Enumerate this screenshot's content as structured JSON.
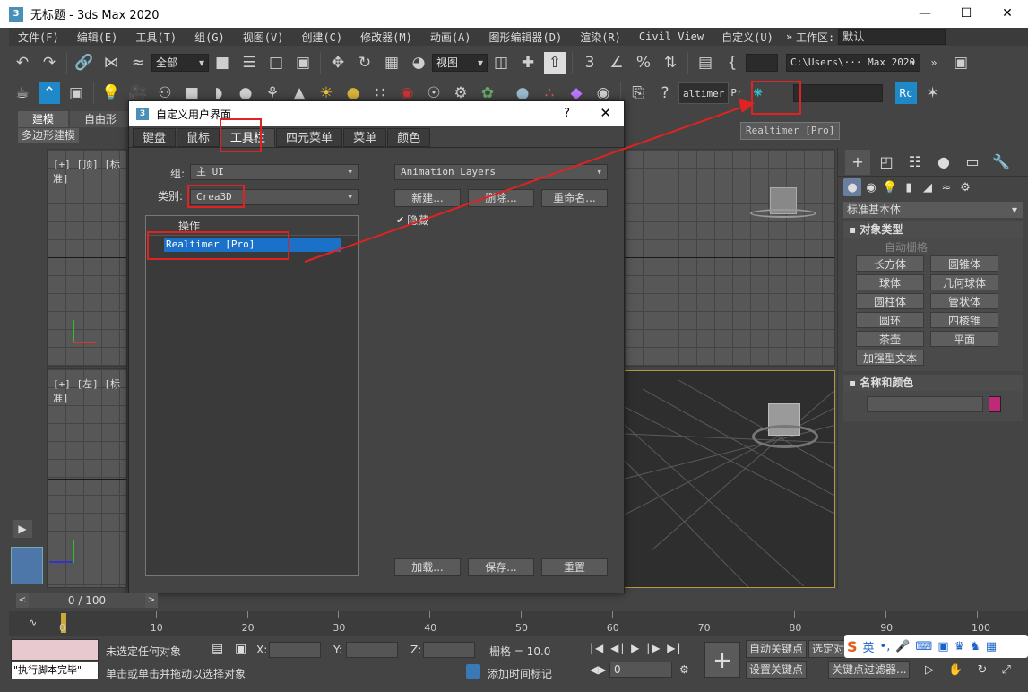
{
  "window": {
    "title": "无标题 - 3ds Max 2020",
    "app_icon": "3",
    "controls": [
      "minimize-icon",
      "maximize-icon",
      "close-icon"
    ]
  },
  "menubar": {
    "items": [
      "文件(F)",
      "编辑(E)",
      "工具(T)",
      "组(G)",
      "视图(V)",
      "创建(C)",
      "修改器(M)",
      "动画(A)",
      "图形编辑器(D)",
      "渲染(R)",
      "Civil View",
      "自定义(U)"
    ],
    "overflow": "»",
    "workspace_label": "工作区:",
    "workspace_value": "默认"
  },
  "toolbar1": {
    "selection_filter": "全部",
    "ref_coord": "视图",
    "path": "C:\\Users\\··· Max 2020"
  },
  "toolbar2": {
    "realtimer_button": "altimer",
    "realtimer_suffix": "Pr"
  },
  "tooltip": "Realtimer [Pro]",
  "ribbon": {
    "tabs": [
      "建模",
      "自由形"
    ],
    "panel": "多边形建模"
  },
  "viewports": {
    "top_label": "[+] [顶] [标准]",
    "left_label": "[+] [左] [标准]"
  },
  "dialog": {
    "title": "自定义用户界面",
    "help": "?",
    "tabs": [
      "键盘",
      "鼠标",
      "工具栏",
      "四元菜单",
      "菜单",
      "颜色"
    ],
    "active_tab": "工具栏",
    "group_label": "组:",
    "group_value": "主 UI",
    "category_label": "类别:",
    "category_value": "Crea3D",
    "list_header": "操作",
    "list_items": [
      "Realtimer [Pro]"
    ],
    "toolbar_select": "Animation Layers",
    "buttons": {
      "new": "新建...",
      "delete": "删除...",
      "rename": "重命名...",
      "load": "加载...",
      "save": "保存...",
      "reset": "重置"
    },
    "hide_checkbox": "隐藏",
    "hide_checked": true
  },
  "command_panel": {
    "category": "标准基本体",
    "object_type_header": "对象类型",
    "autogrid": "自动栅格",
    "objects": [
      "长方体",
      "圆锥体",
      "球体",
      "几何球体",
      "圆柱体",
      "管状体",
      "圆环",
      "四棱锥",
      "茶壶",
      "平面",
      "加强型文本"
    ],
    "name_color_header": "名称和颜色",
    "object_color": "#c0287a"
  },
  "timeline": {
    "frame": "0 / 100",
    "ticks": [
      "0",
      "10",
      "20",
      "30",
      "40",
      "50",
      "60",
      "70",
      "80",
      "90",
      "100"
    ]
  },
  "status": {
    "maxscript_output": "\"执行脚本完毕\"",
    "selection": "未选定任何对象",
    "prompt": "单击或单击并拖动以选择对象",
    "x_label": "X:",
    "y_label": "Y:",
    "z_label": "Z:",
    "grid": "栅格 = 10.0",
    "add_time_tag": "添加时间标记",
    "auto_key": "自动关键点",
    "selected": "选定对象",
    "set_key": "设置关键点",
    "key_filters": "关键点过滤器...",
    "current_frame": "0"
  },
  "ime": {
    "lang": "英"
  },
  "colors": {
    "accent_selection": "#1a71c7",
    "annotation": "#e02222"
  }
}
